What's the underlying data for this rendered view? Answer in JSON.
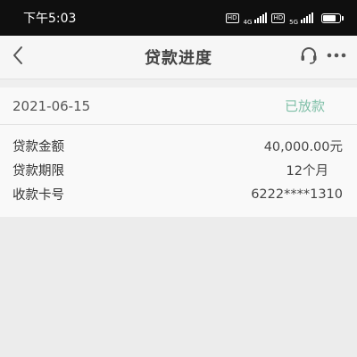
{
  "status_bar": {
    "time": "下午5:03",
    "sim1_badge": "HD",
    "sim1_tech": "4G",
    "sim2_badge": "HD",
    "sim2_tech": "5G",
    "battery_level": 0.85
  },
  "nav": {
    "title": "贷款进度",
    "back_icon": "chevron-left-icon",
    "service_icon": "headset-icon",
    "more_icon": "more-dots-icon"
  },
  "loan": {
    "date": "2021-06-15",
    "status": "已放款",
    "status_color": "#7fbfa7",
    "rows": [
      {
        "label": "贷款金额",
        "value": "40,000.00元"
      },
      {
        "label": "贷款期限",
        "value": "12个月"
      },
      {
        "label": "收款卡号",
        "value": "6222****1310"
      }
    ]
  }
}
